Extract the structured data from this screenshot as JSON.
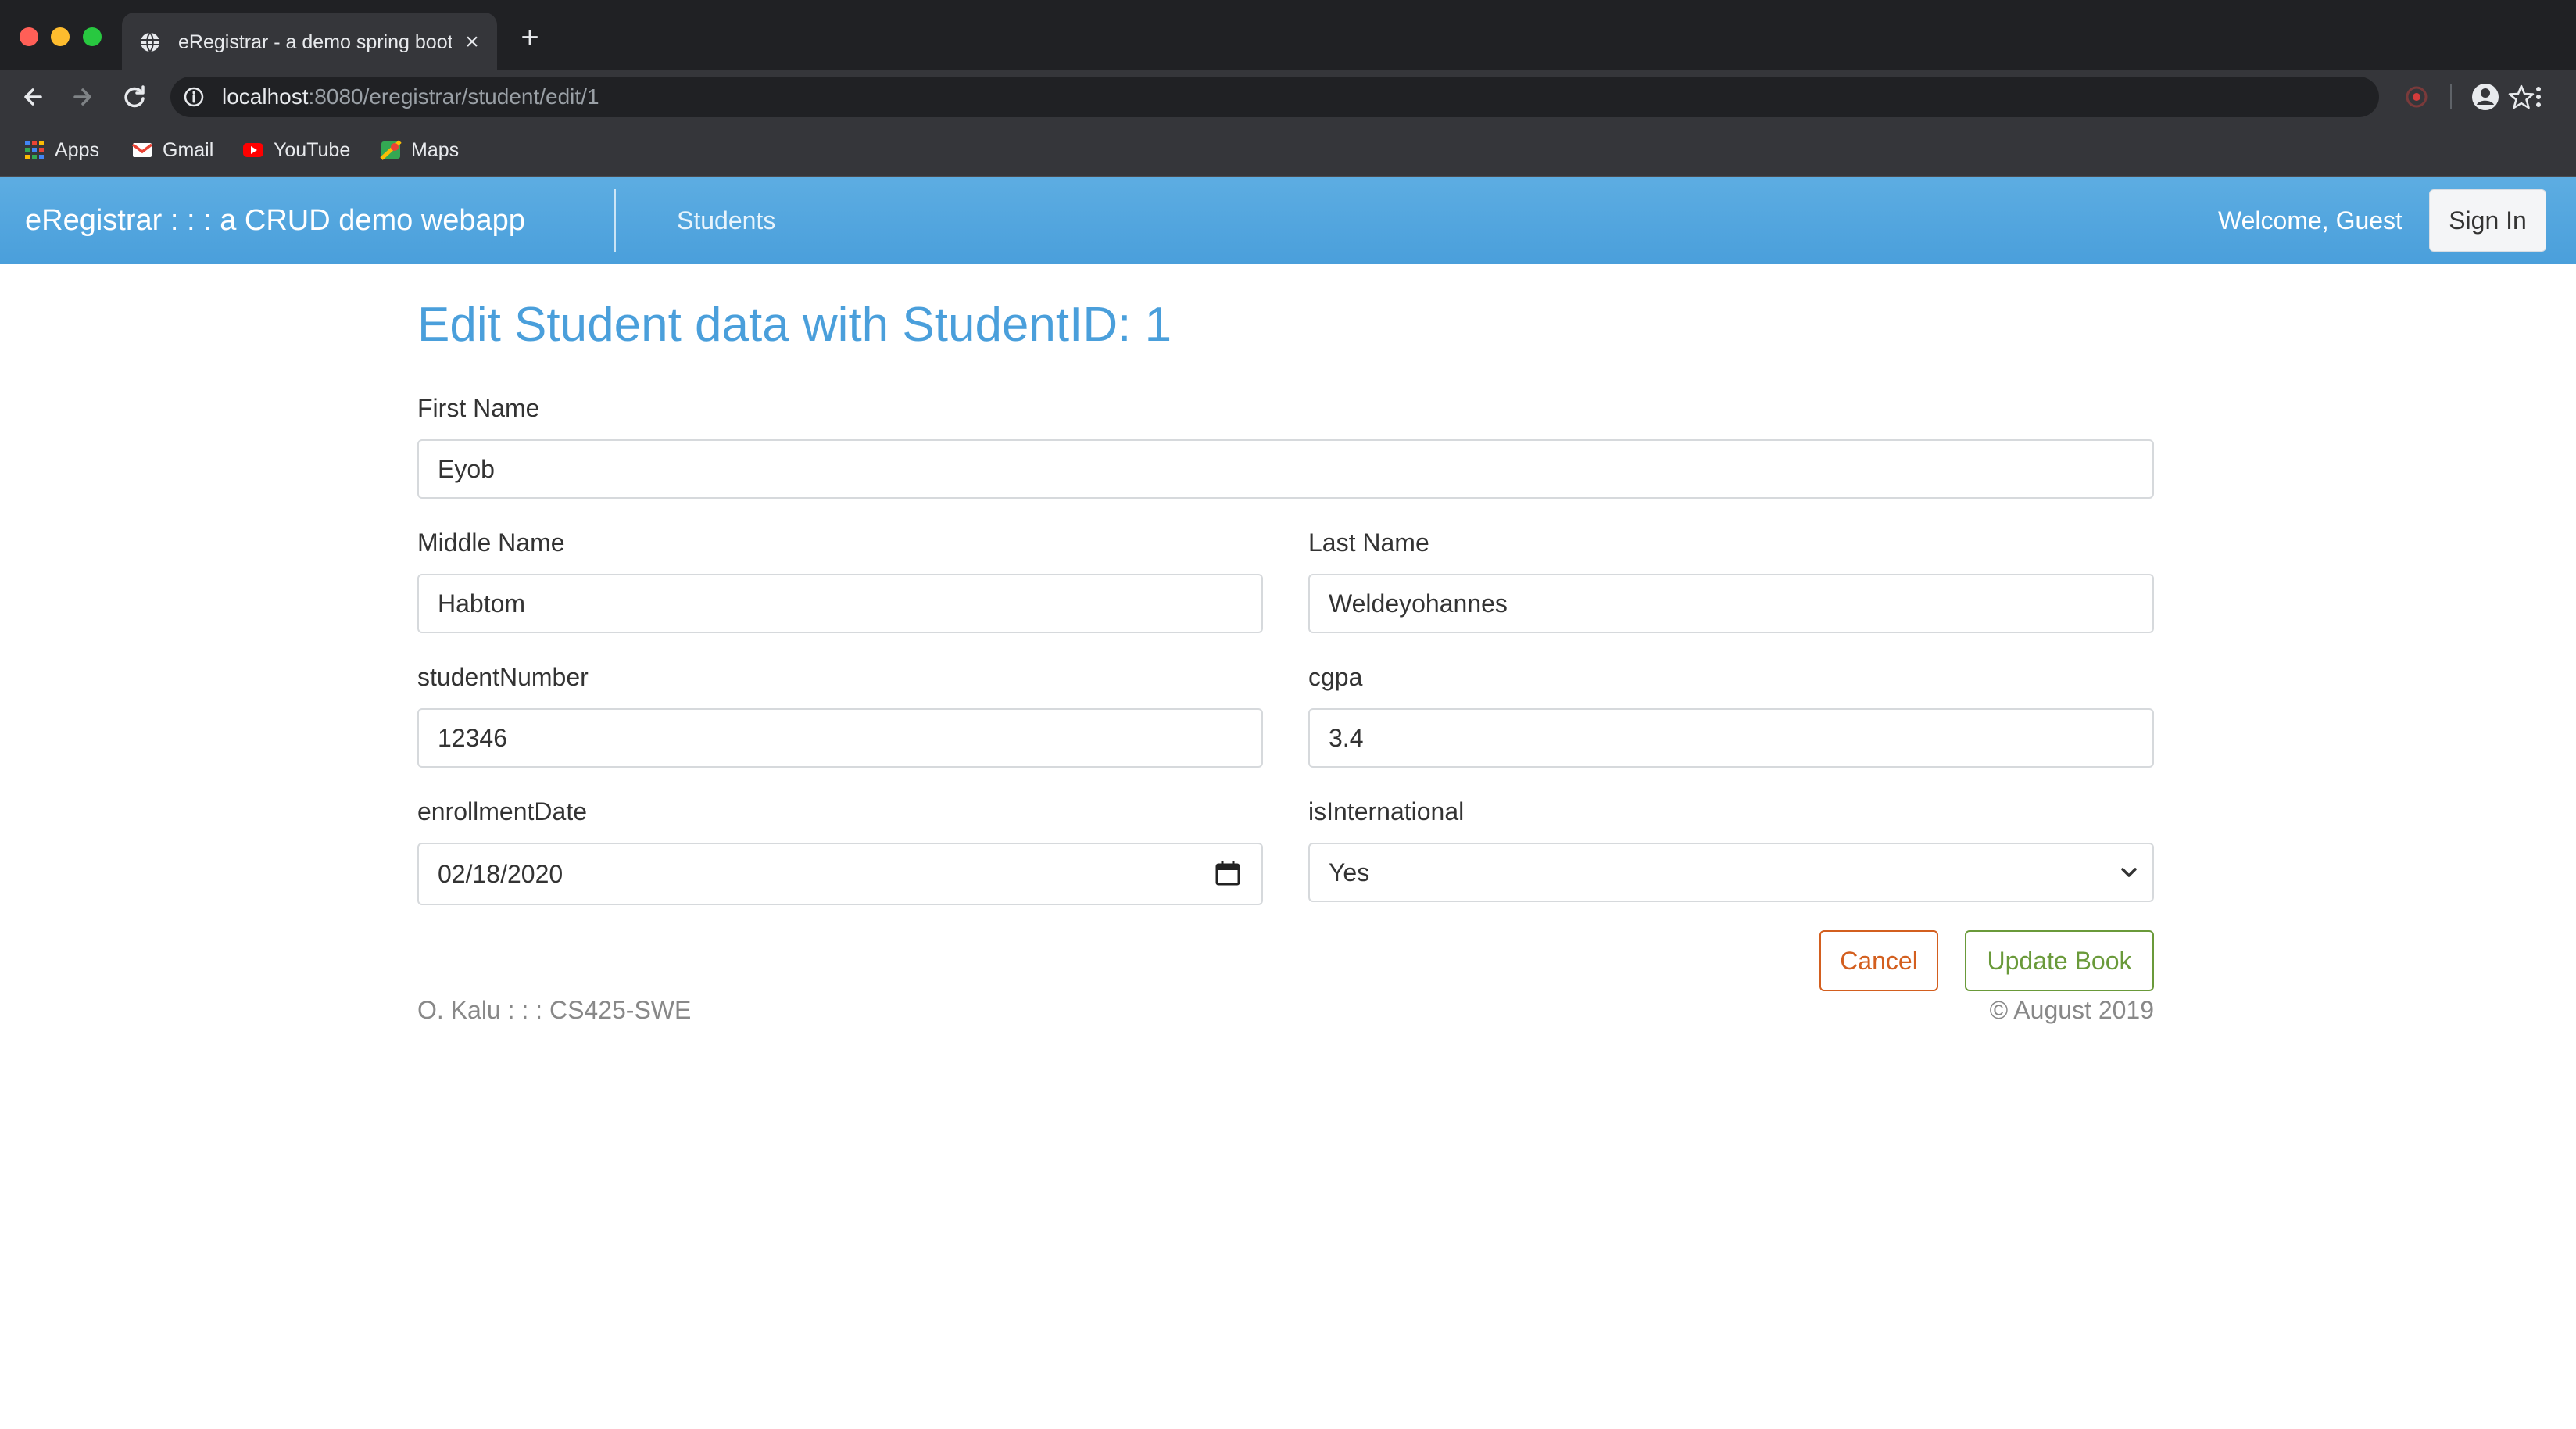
{
  "browser": {
    "tab_title": "eRegistrar - a demo spring boot",
    "tab_close": "×",
    "new_tab": "+",
    "url_host": "localhost",
    "url_rest": ":8080/eregistrar/student/edit/1",
    "bookmarks": [
      {
        "label": "Apps",
        "icon": "apps-grid-icon"
      },
      {
        "label": "Gmail",
        "icon": "gmail-icon"
      },
      {
        "label": "YouTube",
        "icon": "youtube-icon"
      },
      {
        "label": "Maps",
        "icon": "maps-icon"
      }
    ]
  },
  "navbar": {
    "brand": "eRegistrar : : : a CRUD demo webapp",
    "students_link": "Students",
    "welcome": "Welcome, Guest",
    "signin": "Sign In",
    "color": "#4a9fdb"
  },
  "form": {
    "heading": "Edit Student data with StudentID: 1",
    "first_name": {
      "label": "First Name",
      "value": "Eyob"
    },
    "middle_name": {
      "label": "Middle Name",
      "value": "Habtom"
    },
    "last_name": {
      "label": "Last Name",
      "value": "Weldeyohannes"
    },
    "student_number": {
      "label": "studentNumber",
      "value": "12346"
    },
    "cgpa": {
      "label": "cgpa",
      "value": "3.4"
    },
    "enrollment_date": {
      "label": "enrollmentDate",
      "value": "02/18/2020"
    },
    "is_international": {
      "label": "isInternational",
      "value": "Yes"
    },
    "cancel": "Cancel",
    "update": "Update Book"
  },
  "footer": {
    "left": "O. Kalu : : : CS425-SWE",
    "right": "© August 2019"
  }
}
